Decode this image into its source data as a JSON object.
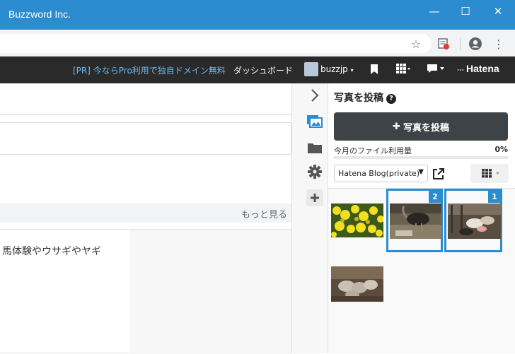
{
  "window": {
    "title": "Buzzword Inc.",
    "minimize_glyph": "—",
    "maximize_glyph": "☐",
    "close_glyph": "✕"
  },
  "toolbar": {
    "star_glyph": "☆",
    "menu_glyph": "⋮"
  },
  "hatena_bar": {
    "promo": "[PR] 今ならPro利用で独自ドメイン無料",
    "dashboard": "ダッシュボード",
    "username": "buzzjp",
    "logo": "Hatena"
  },
  "main": {
    "more_link": "もっと見る",
    "article_excerpt": "馬体験やウサギやヤギ"
  },
  "panel": {
    "title": "写真を投稿",
    "help_glyph": "?",
    "post_button": "写真を投稿",
    "usage_label": "今月のファイル利用量",
    "usage_percent": "0%",
    "usage_value": 0,
    "blog_select": "Hatena Blog(private)",
    "photos": [
      {
        "name": "photo-rapeseed-flowers",
        "selected": false,
        "order": ""
      },
      {
        "name": "photo-ostrich-enclosure",
        "selected": true,
        "order": "2"
      },
      {
        "name": "photo-goats-pen",
        "selected": true,
        "order": "1"
      },
      {
        "name": "photo-sheep-herd",
        "selected": false,
        "order": ""
      }
    ]
  },
  "colors": {
    "titlebar": "#2b8ccf",
    "hatena_bar": "#2a2a2a",
    "post_button": "#3d4347",
    "selection": "#2b8ccf",
    "promo_link": "#6db8f0"
  }
}
